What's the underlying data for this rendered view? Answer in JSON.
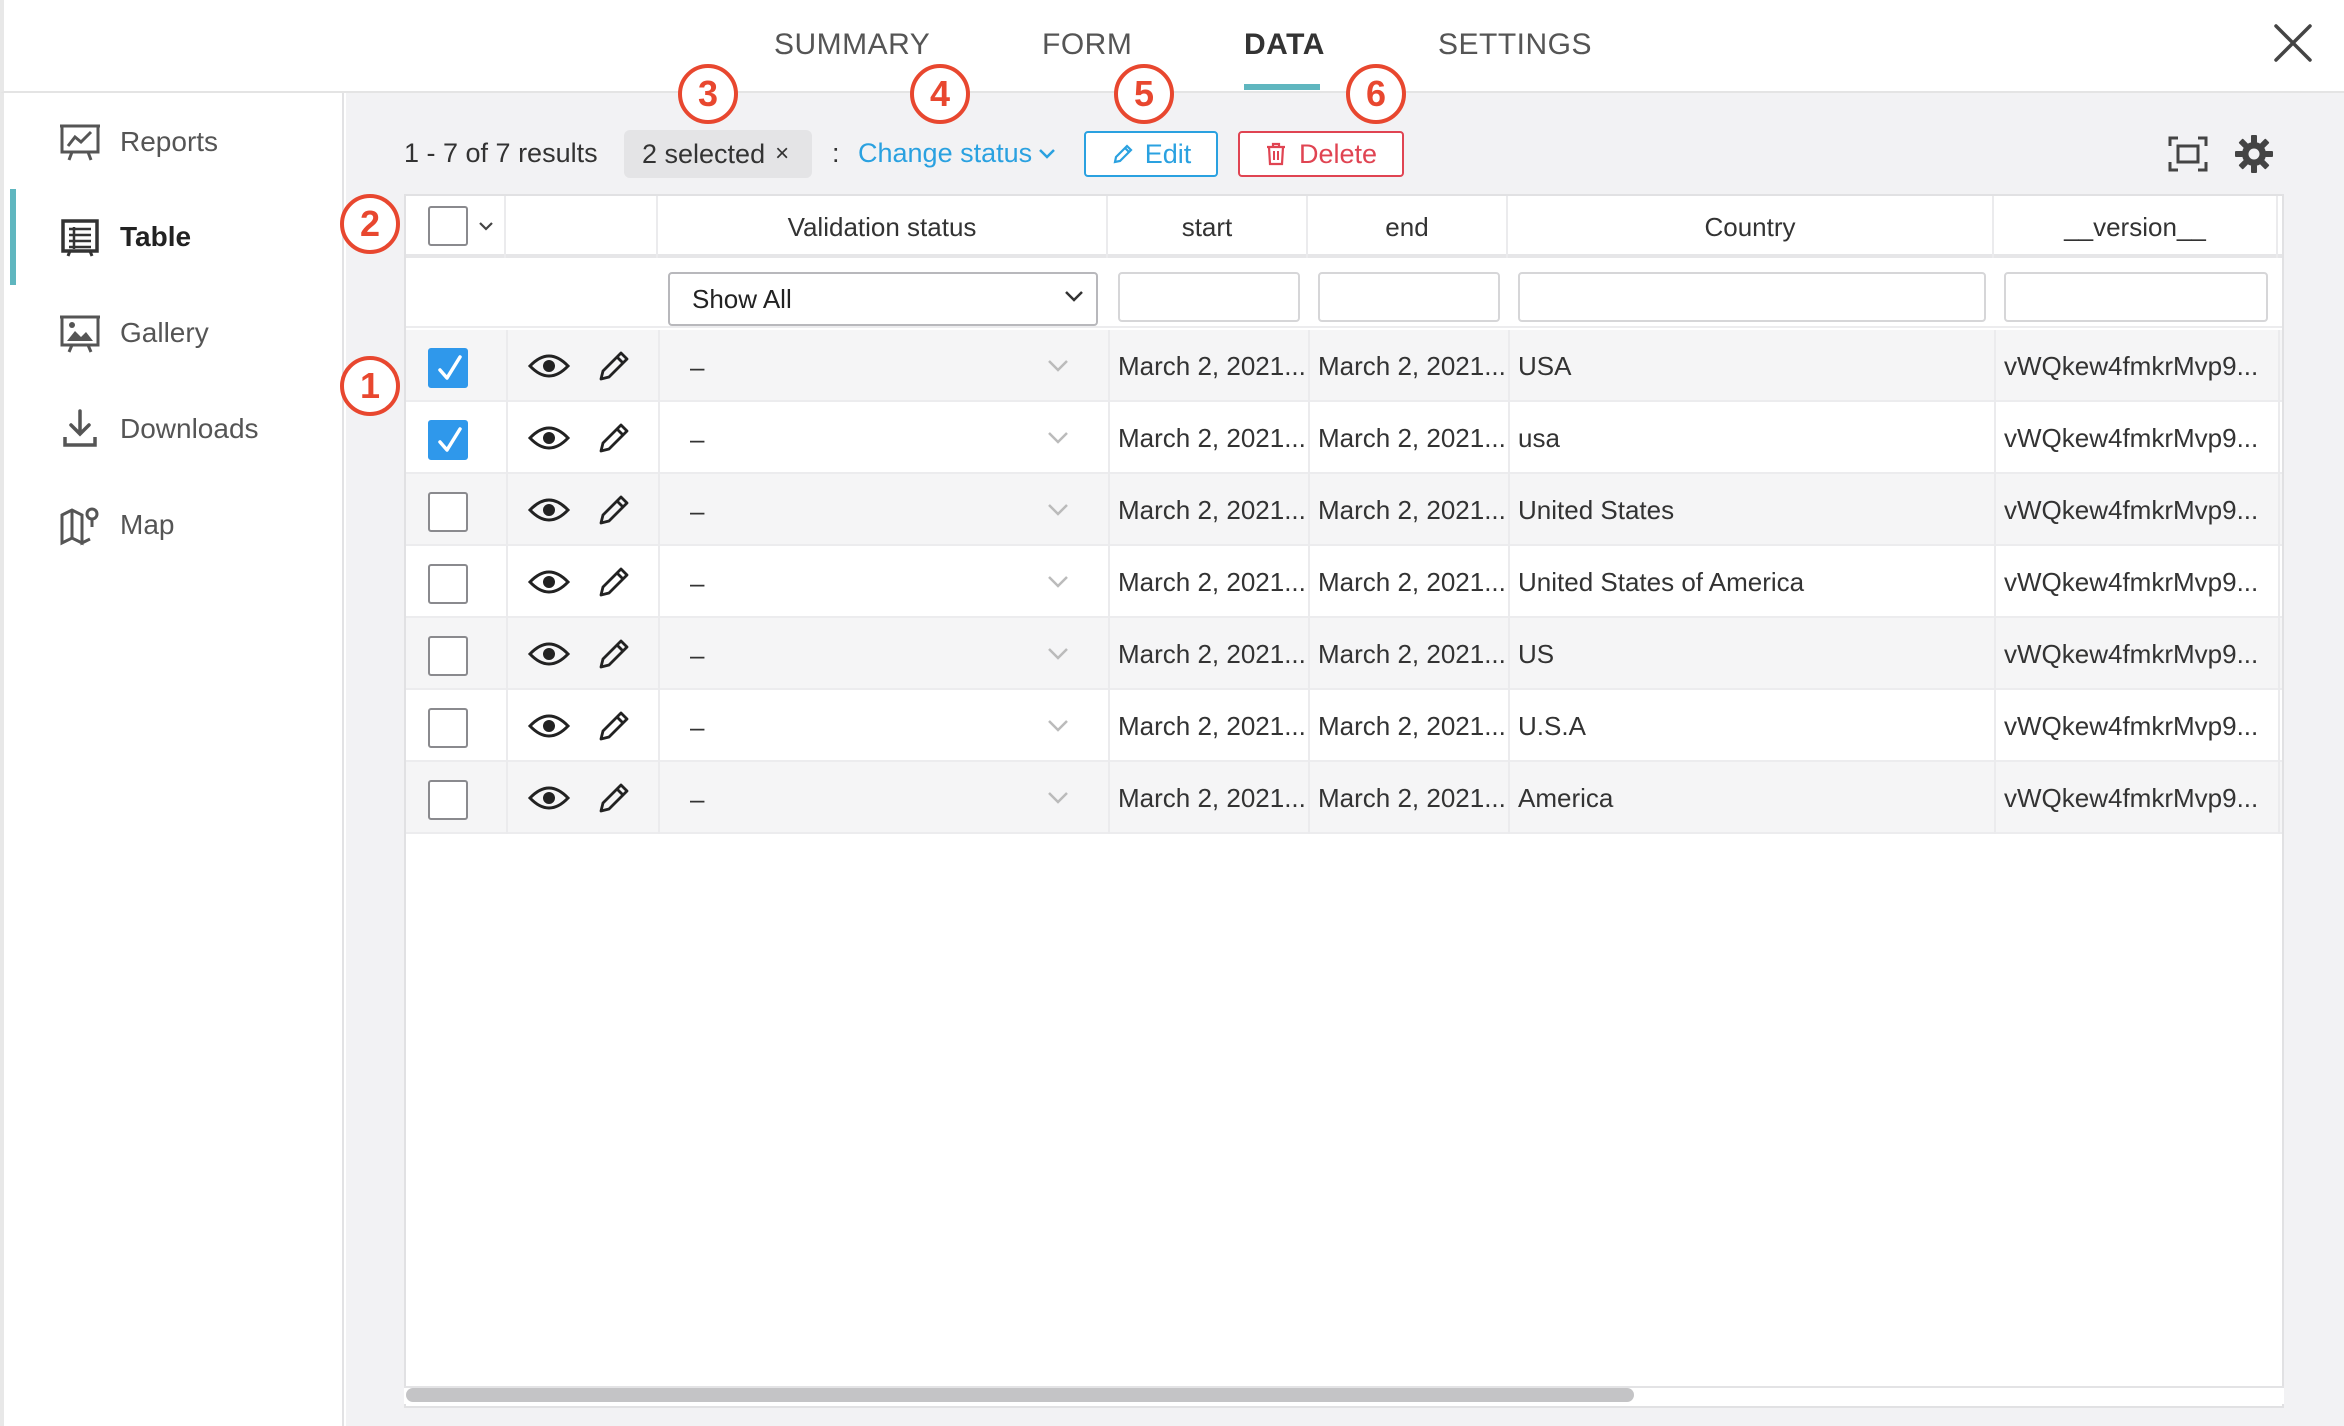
{
  "nav": {
    "tabs": [
      {
        "label": "SUMMARY",
        "active": false
      },
      {
        "label": "FORM",
        "active": false
      },
      {
        "label": "DATA",
        "active": true
      },
      {
        "label": "SETTINGS",
        "active": false
      }
    ],
    "close_icon": "close-icon"
  },
  "sidebar": {
    "items": [
      {
        "label": "Reports",
        "icon": "reports-icon",
        "active": false
      },
      {
        "label": "Table",
        "icon": "table-icon",
        "active": true
      },
      {
        "label": "Gallery",
        "icon": "gallery-icon",
        "active": false
      },
      {
        "label": "Downloads",
        "icon": "download-icon",
        "active": false
      },
      {
        "label": "Map",
        "icon": "map-icon",
        "active": false
      }
    ]
  },
  "toolbar": {
    "results": "1 - 7 of 7 results",
    "selected": "2 selected",
    "selected_clear": "×",
    "colon": ":",
    "change_status": "Change status",
    "edit": "Edit",
    "delete": "Delete"
  },
  "badges": [
    "3",
    "4",
    "5",
    "6",
    "2",
    "1"
  ],
  "table": {
    "headers": {
      "validation": "Validation status",
      "start": "start",
      "end": "end",
      "country": "Country",
      "version": "__version__"
    },
    "filter_select": "Show All",
    "rows": [
      {
        "checked": true,
        "status": "–",
        "start": "March 2, 2021...",
        "end": "March 2, 2021...",
        "country": "USA",
        "version": "vWQkew4fmkrMvp9..."
      },
      {
        "checked": true,
        "status": "–",
        "start": "March 2, 2021...",
        "end": "March 2, 2021...",
        "country": "usa",
        "version": "vWQkew4fmkrMvp9..."
      },
      {
        "checked": false,
        "status": "–",
        "start": "March 2, 2021...",
        "end": "March 2, 2021...",
        "country": "United States",
        "version": "vWQkew4fmkrMvp9..."
      },
      {
        "checked": false,
        "status": "–",
        "start": "March 2, 2021...",
        "end": "March 2, 2021...",
        "country": "United States of America",
        "version": "vWQkew4fmkrMvp9..."
      },
      {
        "checked": false,
        "status": "–",
        "start": "March 2, 2021...",
        "end": "March 2, 2021...",
        "country": "US",
        "version": "vWQkew4fmkrMvp9..."
      },
      {
        "checked": false,
        "status": "–",
        "start": "March 2, 2021...",
        "end": "March 2, 2021...",
        "country": "U.S.A",
        "version": "vWQkew4fmkrMvp9..."
      },
      {
        "checked": false,
        "status": "–",
        "start": "March 2, 2021...",
        "end": "March 2, 2021...",
        "country": "America",
        "version": "vWQkew4fmkrMvp9..."
      }
    ]
  },
  "colors": {
    "accent": "#5fb6bf",
    "link": "#2aa1e0",
    "danger": "#e04452",
    "badge": "#e8472f",
    "checkbox": "#2f98eb"
  }
}
